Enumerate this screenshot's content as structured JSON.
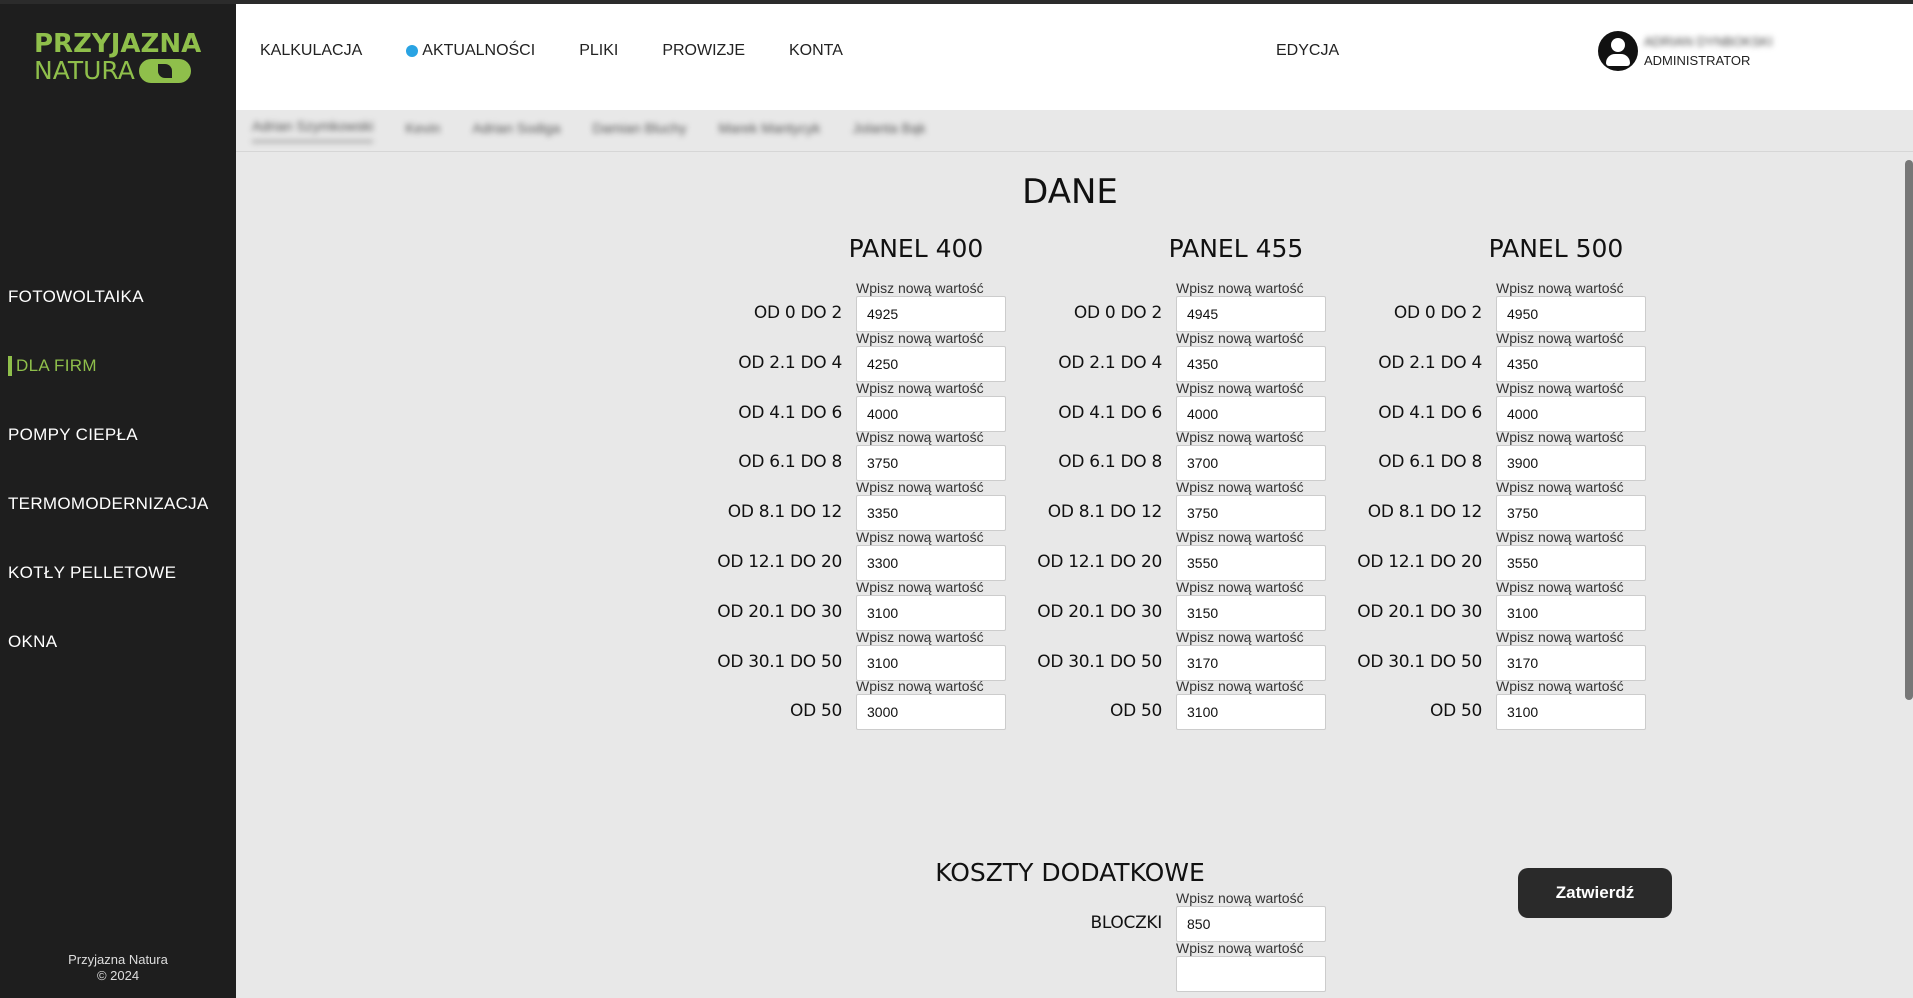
{
  "logo": {
    "line1": "PRZYJAZNA",
    "line2": "NATURA"
  },
  "sidebar": {
    "items": [
      {
        "label": "FOTOWOLTAIKA"
      },
      {
        "label": "DLA FIRM",
        "active": true
      },
      {
        "label": "POMPY CIEPŁA"
      },
      {
        "label": "TERMOMODERNIZACJA"
      },
      {
        "label": "KOTŁY PELLETOWE"
      },
      {
        "label": "OKNA"
      }
    ],
    "footer_line1": "Przyjazna Natura",
    "footer_line2": "© 2024"
  },
  "header": {
    "nav": [
      "KALKULACJA",
      "AKTUALNOŚCI",
      "PLIKI",
      "PROWIZJE",
      "KONTA"
    ],
    "edit_label": "EDYCJA",
    "user_name": "ADRIAN DYNBOKSKI",
    "user_role": "ADMINISTRATOR"
  },
  "subtabs": [
    "Adrian Szymkowski",
    "Kevin",
    "Adrian Sodiga",
    "Damian Bluchy",
    "Marek Mantycyk",
    "Jolanta Bąk"
  ],
  "main": {
    "title": "DANE",
    "placeholder": "Wpisz nową wartość",
    "submit_label": "Zatwierdź",
    "panels": [
      {
        "title": "PANEL 400",
        "rows": [
          {
            "label": "OD 0 DO 2",
            "value": "4925"
          },
          {
            "label": "OD 2.1 DO 4",
            "value": "4250"
          },
          {
            "label": "OD 4.1 DO 6",
            "value": "4000"
          },
          {
            "label": "OD 6.1 DO 8",
            "value": "3750"
          },
          {
            "label": "OD 8.1 DO 12",
            "value": "3350"
          },
          {
            "label": "OD 12.1 DO 20",
            "value": "3300"
          },
          {
            "label": "OD 20.1 DO 30",
            "value": "3100"
          },
          {
            "label": "OD 30.1 DO 50",
            "value": "3100"
          },
          {
            "label": "OD 50",
            "value": "3000"
          }
        ]
      },
      {
        "title": "PANEL 455",
        "rows": [
          {
            "label": "OD 0 DO 2",
            "value": "4945"
          },
          {
            "label": "OD 2.1 DO 4",
            "value": "4350"
          },
          {
            "label": "OD 4.1 DO 6",
            "value": "4000"
          },
          {
            "label": "OD 6.1 DO 8",
            "value": "3700"
          },
          {
            "label": "OD 8.1 DO 12",
            "value": "3750"
          },
          {
            "label": "OD 12.1 DO 20",
            "value": "3550"
          },
          {
            "label": "OD 20.1 DO 30",
            "value": "3150"
          },
          {
            "label": "OD 30.1 DO 50",
            "value": "3170"
          },
          {
            "label": "OD 50",
            "value": "3100"
          }
        ]
      },
      {
        "title": "PANEL 500",
        "rows": [
          {
            "label": "OD 0 DO 2",
            "value": "4950"
          },
          {
            "label": "OD 2.1 DO 4",
            "value": "4350"
          },
          {
            "label": "OD 4.1 DO 6",
            "value": "4000"
          },
          {
            "label": "OD 6.1 DO 8",
            "value": "3900"
          },
          {
            "label": "OD 8.1 DO 12",
            "value": "3750"
          },
          {
            "label": "OD 12.1 DO 20",
            "value": "3550"
          },
          {
            "label": "OD 20.1 DO 30",
            "value": "3100"
          },
          {
            "label": "OD 30.1 DO 50",
            "value": "3170"
          },
          {
            "label": "OD 50",
            "value": "3100"
          }
        ]
      }
    ],
    "extra": {
      "title": "KOSZTY DODATKOWE",
      "rows": [
        {
          "label": "BLOCZKI",
          "value": "850"
        },
        {
          "label": "",
          "value": ""
        }
      ]
    }
  },
  "colors": {
    "accent": "#8fbf4b",
    "sidebar_bg": "#1e1e1e",
    "dot": "#29a3e3",
    "submit_bg": "#2a2a2a"
  }
}
